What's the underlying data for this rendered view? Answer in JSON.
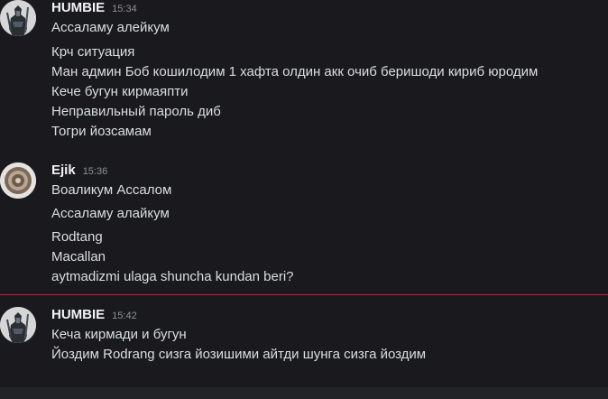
{
  "messages": [
    {
      "username": "HUMBIE",
      "time": "15:34",
      "avatar_icon": "warrior-avatar-icon",
      "lines": [
        "Ассаламу алейкум",
        "Крч ситуация",
        "Ман админ Боб кошилодим 1 хафта олдин акк очиб беришоди кириб юродим",
        "Кече бугун кирмаяпти",
        "Неправильный пароль диб",
        "Тогри йозсамам"
      ]
    },
    {
      "username": "Ejik",
      "time": "15:36",
      "avatar_icon": "round-emblem-avatar-icon",
      "lines": [
        "Воаликум Ассалом",
        "Ассаламу алайкум",
        "Rodtang",
        "Macallan",
        "aytmadizmi ulaga shuncha kundan beri?"
      ]
    },
    {
      "username": "HUMBIE",
      "time": "15:42",
      "avatar_icon": "warrior-avatar-icon",
      "lines": [
        "Кеча кирмади и бугун",
        "Йоздим Rodrang сизга йозишими айтди шунга сизга йоздим"
      ]
    }
  ],
  "colors": {
    "background": "#1a1a1e",
    "username": "#f2f3f5",
    "message_text": "#dbdee1",
    "timestamp": "#8e9297",
    "new_messages_divider": "#a0333b"
  }
}
